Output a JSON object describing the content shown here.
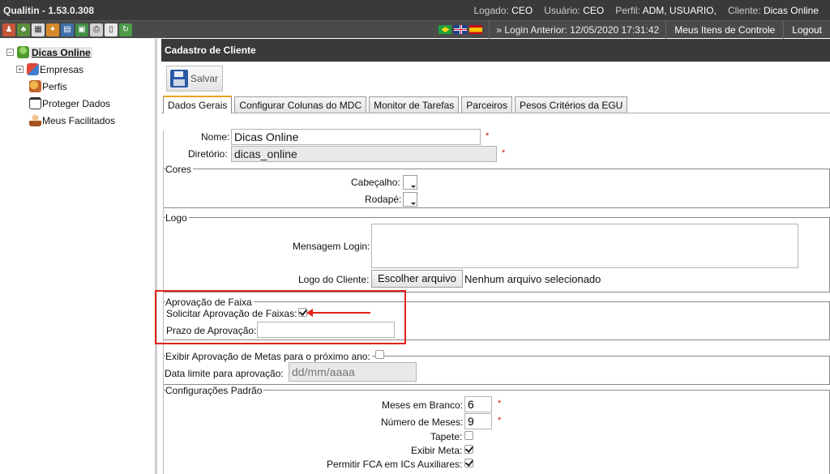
{
  "app": {
    "title": "Qualitin - 1.53.0.308",
    "logged_label": "Logado:",
    "logged_value": "CEO",
    "user_label": "Usuário:",
    "user_value": "CEO",
    "profile_label": "Perfil:",
    "profile_value": "ADM, USUARIO,",
    "client_label": "Cliente:",
    "client_value": "Dicas Online"
  },
  "toolbar": {
    "icons": [
      "users-icon",
      "org-icon",
      "calendar-icon",
      "tasks-icon",
      "docs-icon",
      "export-icon",
      "print-icon",
      "book-icon",
      "refresh-icon"
    ],
    "flags": [
      "brazil-flag",
      "uk-flag",
      "spain-flag"
    ],
    "last_login": "» Login Anterior: 12/05/2020 17:31:42",
    "my_items": "Meus Itens de Controle",
    "logout": "Logout"
  },
  "tree": {
    "root": "Dicas Online",
    "root_toggle": "−",
    "children": [
      {
        "label": "Empresas",
        "toggle": "+",
        "icon": "companies-icon"
      },
      {
        "label": "Perfis",
        "icon": "profiles-icon"
      },
      {
        "label": "Proteger Dados",
        "icon": "calendar-lock-icon"
      },
      {
        "label": "Meus Facilitados",
        "icon": "person-icon"
      }
    ]
  },
  "panel": {
    "header": "Cadastro de Cliente",
    "save_label": "Salvar",
    "tabs": [
      "Dados Gerais",
      "Configurar Colunas do MDC",
      "Monitor de Tarefas",
      "Parceiros",
      "Pesos Critérios da EGU"
    ],
    "active_tab": "Dados Gerais"
  },
  "form": {
    "name_label": "Nome:",
    "name_value": "Dicas Online",
    "dir_label": "Diretório:",
    "dir_value": "dicas_online",
    "required_mark": "*",
    "cores_legend": "Cores",
    "header_color_label": "Cabeçalho:",
    "footer_color_label": "Rodapé:",
    "logo_legend": "Logo",
    "login_msg_label": "Mensagem Login:",
    "client_logo_label": "Logo do Cliente:",
    "choose_file": "Escolher arquivo",
    "no_file": "Nenhum arquivo selecionado",
    "approval_legend": "Aprovação de Faixa",
    "request_approval_label": "Solicitar Aprovação de Faixas:",
    "request_approval_checked": true,
    "approval_deadline_label": "Prazo de Aprovação:",
    "approval_deadline_value": "",
    "show_goals_label": "Exibir Aprovação de Metas para o próximo ano:",
    "show_goals_checked": false,
    "deadline_date_label": "Data limite para aprovação:",
    "deadline_date_placeholder": "dd/mm/aaaa",
    "defaults_legend": "Configurações Padrão",
    "blank_months_label": "Meses em Branco:",
    "blank_months_value": "6",
    "num_months_label": "Número de Meses:",
    "num_months_value": "9",
    "carpet_label": "Tapete:",
    "carpet_checked": false,
    "show_goal_label": "Exibir Meta:",
    "show_goal_checked": true,
    "allow_fca_label": "Permitir FCA em ICs Auxiliares:",
    "allow_fca_checked": true
  },
  "colors": {
    "topbar": "#3a3a3a",
    "annotation_red": "#e2231a",
    "active_tab_accent": "#e9a322",
    "required_red": "#d01010"
  }
}
